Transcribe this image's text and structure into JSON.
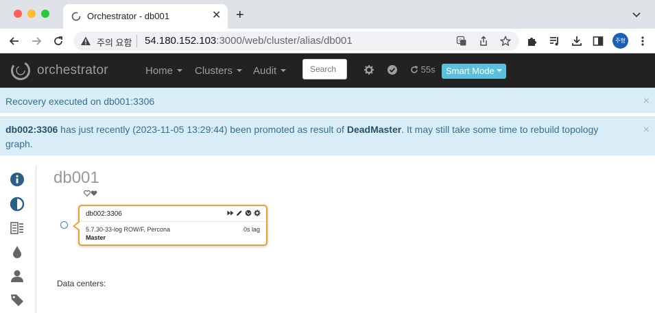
{
  "browser": {
    "tab_title": "Orchestrator - db001",
    "tab_close": "✕",
    "new_tab": "+",
    "security_warning": "주의 요함",
    "url_host": "54.180.152.103",
    "url_path": ":3000/web/cluster/alias/db001",
    "profile_label": "주형"
  },
  "navbar": {
    "brand": "orchestrator",
    "menu": [
      {
        "label": "Home"
      },
      {
        "label": "Clusters"
      },
      {
        "label": "Audit"
      }
    ],
    "search_placeholder": "Search",
    "refresh_countdown": "55s",
    "smart_mode": "Smart Mode"
  },
  "alerts": {
    "recovery": "Recovery executed on db001:3306",
    "promotion": {
      "host": "db002:3306",
      "text_before": " has just recently (2023-11-05 13:29:44) been promoted as result of ",
      "reason": "DeadMaster",
      "text_after": ". It may still take some time to rebuild topology graph."
    },
    "close": "×"
  },
  "cluster": {
    "title": "db001",
    "instance": {
      "name": "db002:3306",
      "version": "5.7.30-33-log ROW/F, Percona",
      "lag": "0s lag",
      "role": "Master"
    },
    "data_centers_label": "Data centers:"
  },
  "colors": {
    "navbar_bg": "#222222",
    "alert_bg": "#d9edf7",
    "alert_text": "#31708f",
    "instance_border": "#f0a030",
    "smart_mode_bg": "#5bc0de",
    "sidebar_icon": "#2b5f86"
  },
  "sidebar_icons": [
    "info-icon",
    "contrast-icon",
    "server-list-icon",
    "drop-icon",
    "user-icon",
    "tag-icon"
  ]
}
